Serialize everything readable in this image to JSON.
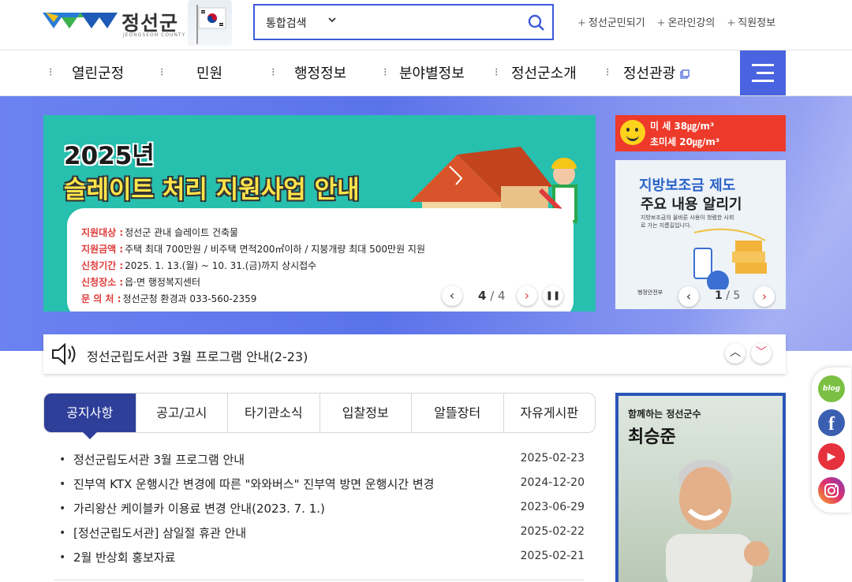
{
  "header": {
    "logo_name": "정선군",
    "logo_sub": "JEONGSEON COUNTY",
    "search": {
      "selected": "통합검색"
    },
    "links": [
      "정선군민되기",
      "온라인강의",
      "직원정보"
    ]
  },
  "nav": {
    "items": [
      "열린군정",
      "민원",
      "행정정보",
      "분야별정보",
      "정선군소개",
      "정선관광"
    ]
  },
  "main_banner": {
    "title_line1": "2025년",
    "title_line2": "슬레이트 처리 지원사업 안내",
    "rows": [
      {
        "label": "지원대상 :",
        "value": "정선군 관내 슬레이트 건축물"
      },
      {
        "label": "지원금액 :",
        "value": "주택 최대 700만원 / 비주택 면적200㎡이하 / 지붕개량 최대 500만원 지원"
      },
      {
        "label": "신청기간 :",
        "value": "2025. 1. 13.(월) ~ 10. 31.(금)까지 상시접수"
      },
      {
        "label": "신청장소 :",
        "value": "읍·면 행정복지센터"
      },
      {
        "label": "문 의 처 :",
        "value": "정선군청 환경과 033-560-2359"
      }
    ],
    "page_current": "4",
    "page_total": "/ 4"
  },
  "dust": {
    "pm10": "미 세 38㎍/m³",
    "pm25": "초미세 20㎍/m³"
  },
  "side_banner": {
    "title1": "지방보조금 제도",
    "title2": "주요 내용 알리기",
    "desc": "지방보조금의 올바른 사용이 청렴한 사회로 가는 지름길입니다.",
    "org": "행정안전부",
    "page_current": "1",
    "page_total": "/ 5"
  },
  "ticker": {
    "text": "정선군립도서관 3월 프로그램 안내(2-23)"
  },
  "tabs": [
    "공지사항",
    "공고/고시",
    "타기관소식",
    "입찰정보",
    "알뜰장터",
    "자유게시판"
  ],
  "notices": [
    {
      "title": "정선군립도서관 3월 프로그램 안내",
      "date": "2025-02-23"
    },
    {
      "title": "진부역 KTX 운행시간 변경에 따른 \"와와버스\" 진부역 방면 운행시간 변경",
      "date": "2024-12-20"
    },
    {
      "title": "가리왕산 케이블카 이용료 변경 안내(2023. 7. 1.)",
      "date": "2023-06-29"
    },
    {
      "title": "[정선군립도서관] 삼일절 휴관 안내",
      "date": "2025-02-22"
    },
    {
      "title": "2월 반상회 홍보자료",
      "date": "2025-02-21"
    }
  ],
  "mayor": {
    "caption": "함께하는 정선군수",
    "name": "최승준"
  },
  "social": {
    "blog_label": "blog",
    "icons": [
      "blog-icon",
      "facebook-icon",
      "youtube-icon",
      "instagram-icon"
    ]
  }
}
